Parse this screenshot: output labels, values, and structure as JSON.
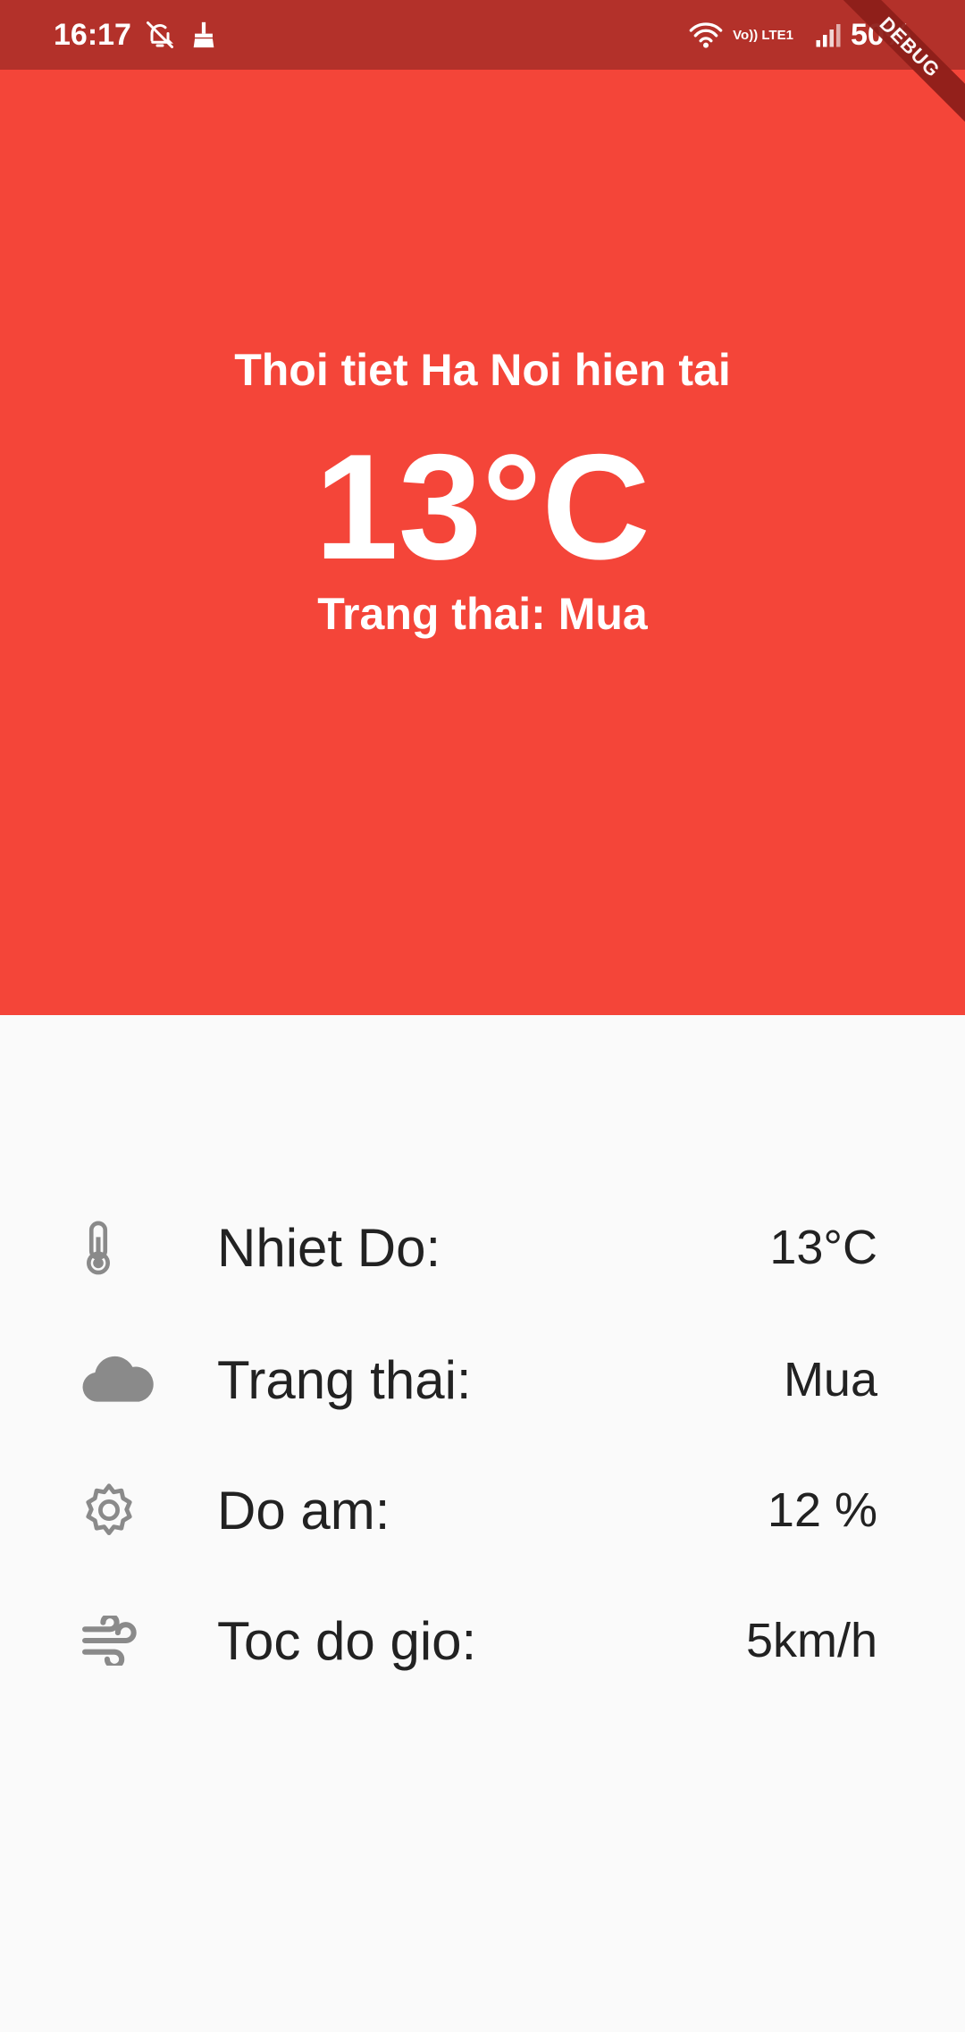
{
  "status_bar": {
    "time": "16:17",
    "network": "Vo)) LTE1",
    "battery": "50%"
  },
  "debug_banner": "DEBUG",
  "colors": {
    "header": "#f44539",
    "status_bar": "#b3312a",
    "background": "#fafafa",
    "icon": "#8a8a8a"
  },
  "hero": {
    "title": "Thoi tiet Ha Noi hien tai",
    "temperature": "13°C",
    "status": "Trang thai: Mua"
  },
  "details": [
    {
      "icon": "thermometer-icon",
      "label": "Nhiet Do:",
      "value": "13°C"
    },
    {
      "icon": "cloud-icon",
      "label": "Trang thai:",
      "value": "Mua"
    },
    {
      "icon": "gear-icon",
      "label": "Do am:",
      "value": "12 %"
    },
    {
      "icon": "wind-icon",
      "label": "Toc do gio:",
      "value": "5km/h"
    }
  ]
}
